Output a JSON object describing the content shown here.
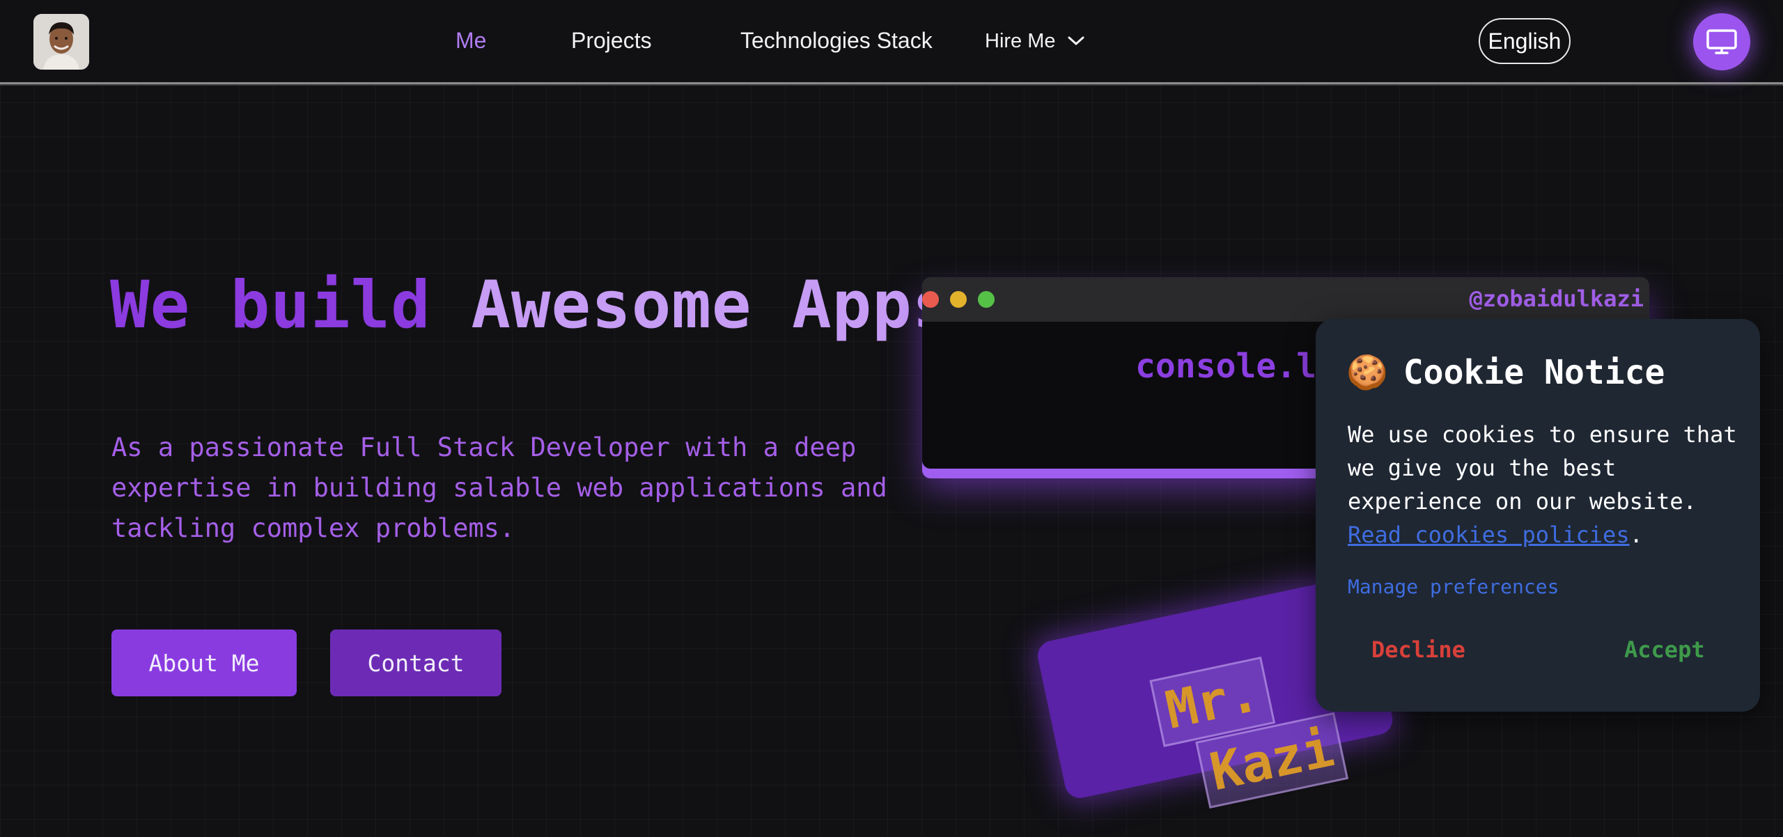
{
  "header": {
    "nav": [
      {
        "label": "Me",
        "active": true
      },
      {
        "label": "Projects"
      },
      {
        "label": "Technologies Stack"
      },
      {
        "label": "Hire Me",
        "has_dropdown": true
      }
    ],
    "language": "English",
    "theme_icon": "monitor-icon"
  },
  "hero": {
    "title_part1": "We build",
    "title_part2": "Awesome Apps",
    "description": "As a passionate Full Stack Developer with a deep expertise in building salable web applications and tackling complex problems.",
    "about_button": "About Me",
    "contact_button": "Contact"
  },
  "code_window": {
    "handle": "@zobaidulkazi",
    "line": "console.l"
  },
  "card": {
    "line1": "Mr.",
    "line2": "Kazi"
  },
  "cookie": {
    "icon": "🍪",
    "title": "Cookie Notice",
    "body": "We use cookies to ensure that we give you the best experience on our website.",
    "link": "Read cookies policies",
    "link_suffix": ".",
    "manage": "Manage preferences",
    "decline": "Decline",
    "accept": "Accept"
  },
  "colors": {
    "accent": "#9b55ee",
    "background": "#111114",
    "cookie_bg": "#1f2733",
    "decline": "#d9403a",
    "accept": "#3e9a4a",
    "link": "#3f6de0"
  }
}
